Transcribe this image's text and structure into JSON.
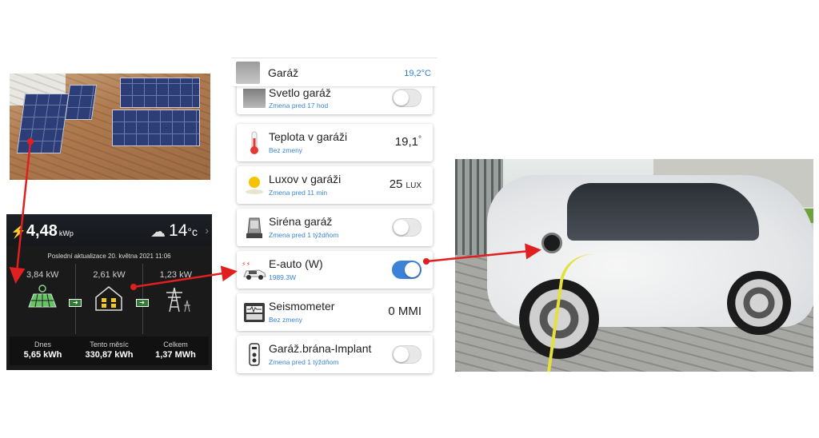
{
  "solar": {
    "power_value": "4,48",
    "power_unit": "kWp",
    "temperature_value": "14",
    "temperature_unit": "°c",
    "last_update": "Poslední aktualizace 20. května 2021 11:06",
    "flows": [
      {
        "value": "3,84 kW",
        "icon": "solar-panel-icon"
      },
      {
        "value": "2,61 kW",
        "icon": "house-icon"
      },
      {
        "value": "1,23 kW",
        "icon": "power-pylon-icon"
      }
    ],
    "stats": [
      {
        "label": "Dnes",
        "value": "5,65 kWh"
      },
      {
        "label": "Tento měsíc",
        "value": "330,87 kWh"
      },
      {
        "label": "Celkem",
        "value": "1,37 MWh"
      }
    ]
  },
  "phone": {
    "header": {
      "title": "Garáž",
      "temperature": "19,2°C"
    },
    "cards": [
      {
        "name": "Svetlo garáž",
        "sub": "Zmena pred 17 hod",
        "kind": "toggle",
        "on": false,
        "icon": "garage-photo-icon"
      },
      {
        "name": "Teplota v garáži",
        "sub": "Bez zmeny",
        "kind": "value",
        "value": "19,1",
        "unit": "°",
        "icon": "thermometer-icon"
      },
      {
        "name": "Luxov v garáži",
        "sub": "Zmena pred 11 min",
        "kind": "value",
        "value": "25",
        "unit": "LUX",
        "icon": "sun-icon"
      },
      {
        "name": "Siréna garáž",
        "sub": "Zmena pred 1 týždňom",
        "kind": "toggle",
        "on": false,
        "icon": "siren-icon"
      },
      {
        "name": "E-auto (W)",
        "sub": "1989.3W",
        "kind": "toggle",
        "on": true,
        "icon": "electric-car-icon"
      },
      {
        "name": "Seismometer",
        "sub": "Bez zmeny",
        "kind": "value",
        "value": "0",
        "unit": "MMI",
        "icon": "seismometer-icon"
      },
      {
        "name": "Garáž.brána-Implant",
        "sub": "Zmena pred 1 týždňom",
        "kind": "toggle",
        "on": false,
        "icon": "remote-control-icon"
      }
    ]
  },
  "colors": {
    "accent_blue": "#3c82d8",
    "arrow_red": "#e02020",
    "flow_green": "#2e7d32"
  }
}
